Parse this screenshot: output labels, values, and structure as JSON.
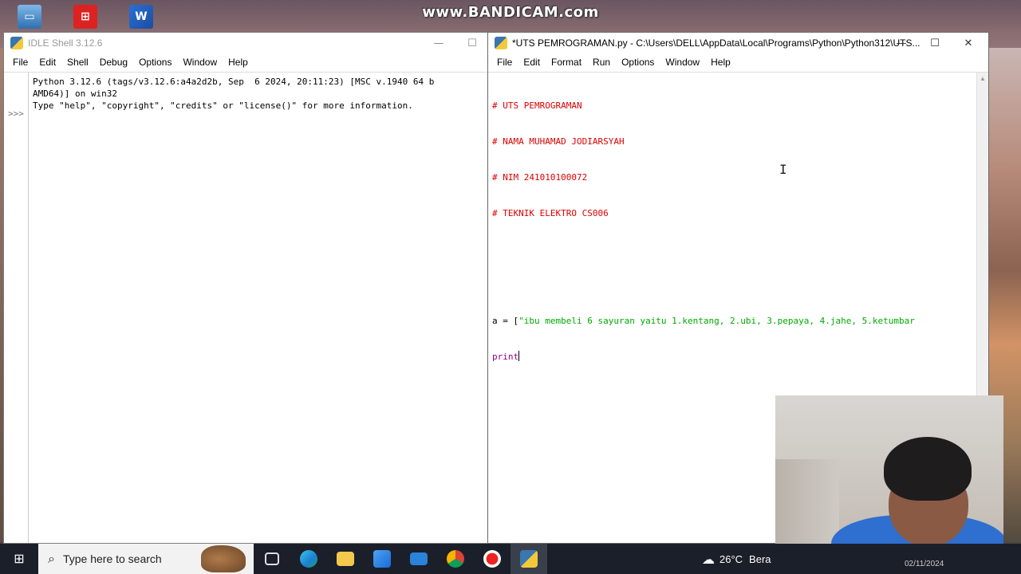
{
  "watermark": "www.BANDICAM.com",
  "desktop": {
    "icons": [
      "computer-icon",
      "tt-app-icon",
      "word-icon"
    ]
  },
  "shell": {
    "title": "IDLE Shell 3.12.6",
    "menu": [
      "File",
      "Edit",
      "Shell",
      "Debug",
      "Options",
      "Window",
      "Help"
    ],
    "lines": [
      "Python 3.12.6 (tags/v3.12.6:a4a2d2b, Sep  6 2024, 20:11:23) [MSC v.1940 64 b",
      "AMD64)] on win32",
      "Type \"help\", \"copyright\", \"credits\" or \"license()\" for more information."
    ],
    "prompt": ">>>"
  },
  "editor": {
    "title": "*UTS PEMROGRAMAN.py - C:\\Users\\DELL\\AppData\\Local\\Programs\\Python\\Python312\\UTS...",
    "menu": [
      "File",
      "Edit",
      "Format",
      "Run",
      "Options",
      "Window",
      "Help"
    ],
    "comments": [
      "# UTS PEMROGRAMAN",
      "# NAMA MUHAMAD JODIARSYAH",
      "# NIM 241010100072",
      "# TEKNIK ELEKTRO CS006"
    ],
    "assign_prefix": "a = [",
    "assign_string": "\"ibu membeli 6 sayuran yaitu 1.kentang, 2.ubi, 3.pepaya, 4.jahe, 5.ketumbar",
    "print_kw": "print"
  },
  "window_controls": {
    "minimize": "—",
    "maximize": "☐",
    "close": "✕"
  },
  "taskbar": {
    "search_placeholder": "Type here to search",
    "weather": "26°C",
    "weather_text": "Bera",
    "clock": "02/11/2024"
  }
}
